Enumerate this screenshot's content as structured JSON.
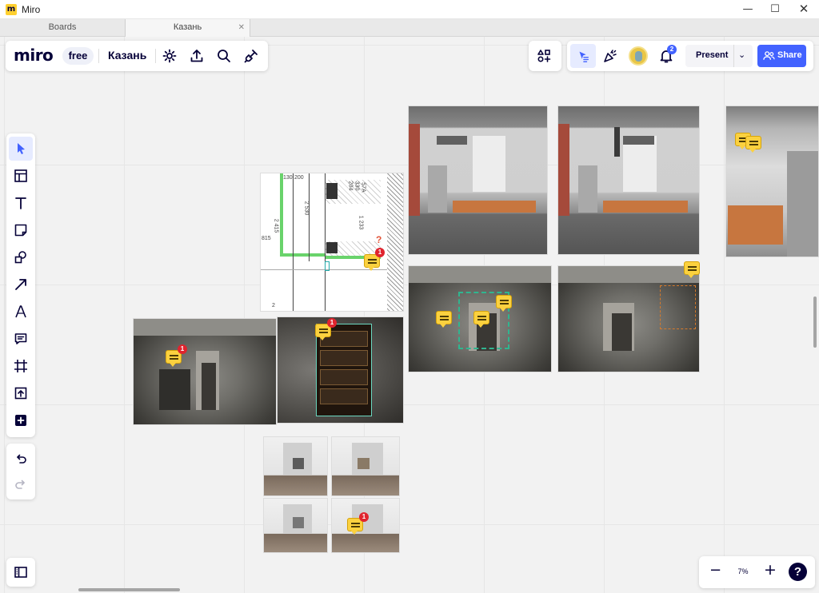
{
  "window": {
    "title": "Miro",
    "minimize_glyph": "—",
    "maximize_glyph": "☐",
    "close_glyph": "✕"
  },
  "tabs": [
    {
      "label": "Boards",
      "active": false
    },
    {
      "label": "Казань",
      "active": true,
      "close_glyph": "✕"
    }
  ],
  "header": {
    "logo": "miro",
    "plan": "free",
    "board_name": "Казань"
  },
  "top_icons": [
    "settings-icon",
    "export-icon",
    "search-icon",
    "plugin-icon"
  ],
  "right_bar": {
    "notification_count": "2",
    "present_label": "Present",
    "present_caret": "⌄",
    "share_label": "Share",
    "accent_color": "#4262ff"
  },
  "tools": [
    "select-tool",
    "templates-tool",
    "text-tool",
    "sticky-note-tool",
    "shapes-tool",
    "connection-line-tool",
    "pen-tool",
    "comment-tool",
    "frame-tool",
    "upload-tool",
    "more-tools"
  ],
  "zoom": {
    "minus": "−",
    "level": "7%",
    "plus": "+",
    "help": "?"
  },
  "comment_badges": {
    "drawing": "1",
    "photo_left": "1",
    "shelving": "1",
    "kitchen": "1"
  },
  "drawing_labels": {
    "d1": "130",
    "d2": "200",
    "d3": "2 530",
    "d4": "2 415",
    "d5": "815",
    "d6": "1 233",
    "d7": "204",
    "d8": "330",
    "d9": "57А",
    "d10": "2",
    "question": "?"
  }
}
